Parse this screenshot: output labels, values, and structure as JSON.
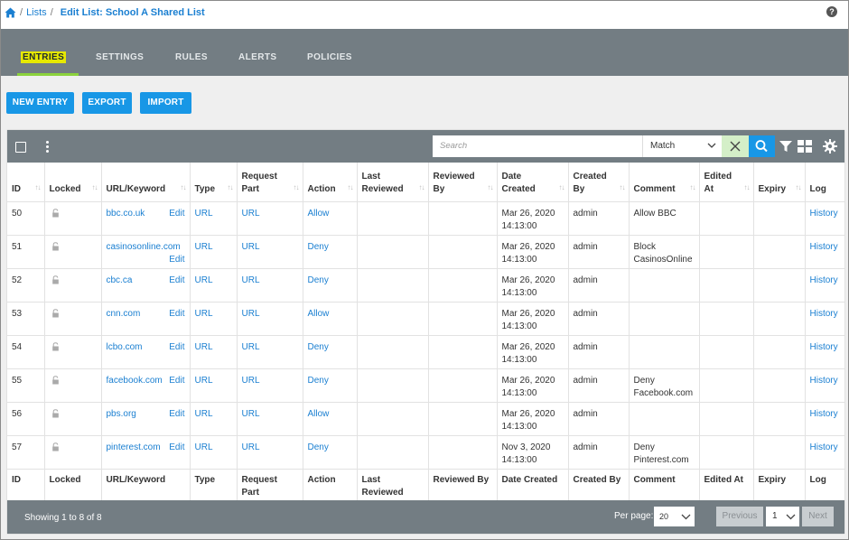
{
  "breadcrumb": {
    "lists_label": "Lists",
    "sep": "/",
    "current": "Edit List: School A Shared List"
  },
  "help_label": "?",
  "tabs": [
    {
      "label": "ENTRIES",
      "active": true
    },
    {
      "label": "SETTINGS",
      "active": false
    },
    {
      "label": "RULES",
      "active": false
    },
    {
      "label": "ALERTS",
      "active": false
    },
    {
      "label": "POLICIES",
      "active": false
    }
  ],
  "actions": {
    "new_entry": "NEW ENTRY",
    "export": "EXPORT",
    "import": "IMPORT"
  },
  "toolbar": {
    "search_placeholder": "Search",
    "match_value": "Match"
  },
  "columns": {
    "id": "ID",
    "locked": "Locked",
    "url": "URL/Keyword",
    "type": "Type",
    "request_part_1": "Request",
    "request_part_2": "Part",
    "action": "Action",
    "last_reviewed_1": "Last",
    "last_reviewed_2": "Reviewed",
    "reviewed_by_1": "Reviewed",
    "reviewed_by_2": "By",
    "date_created_1": "Date",
    "date_created_2": "Created",
    "created_by_1": "Created",
    "created_by_2": "By",
    "comment": "Comment",
    "edited_at_1": "Edited",
    "edited_at_2": "At",
    "expiry": "Expiry",
    "log": "Log"
  },
  "footer_columns": {
    "id": "ID",
    "locked": "Locked",
    "url": "URL/Keyword",
    "type": "Type",
    "request_part_1": "Request",
    "request_part_2": "Part",
    "action": "Action",
    "last_reviewed_1": "Last",
    "last_reviewed_2": "Reviewed",
    "reviewed_by": "Reviewed By",
    "date_created": "Date Created",
    "created_by": "Created By",
    "comment": "Comment",
    "edited_at": "Edited At",
    "expiry": "Expiry",
    "log": "Log"
  },
  "edit_label": "Edit",
  "rows": [
    {
      "id": "50",
      "url": "bbc.co.uk",
      "type": "URL",
      "part": "URL",
      "action": "Allow",
      "date1": "Mar 26, 2020",
      "date2": "14:13:00",
      "by": "admin",
      "comment1": "Allow BBC",
      "comment2": "",
      "log": "History"
    },
    {
      "id": "51",
      "url": "casinosonline.com",
      "type": "URL",
      "part": "URL",
      "action": "Deny",
      "date1": "Mar 26, 2020",
      "date2": "14:13:00",
      "by": "admin",
      "comment1": "Block",
      "comment2": "CasinosOnline",
      "log": "History"
    },
    {
      "id": "52",
      "url": "cbc.ca",
      "type": "URL",
      "part": "URL",
      "action": "Deny",
      "date1": "Mar 26, 2020",
      "date2": "14:13:00",
      "by": "admin",
      "comment1": "",
      "comment2": "",
      "log": "History"
    },
    {
      "id": "53",
      "url": "cnn.com",
      "type": "URL",
      "part": "URL",
      "action": "Allow",
      "date1": "Mar 26, 2020",
      "date2": "14:13:00",
      "by": "admin",
      "comment1": "",
      "comment2": "",
      "log": "History"
    },
    {
      "id": "54",
      "url": "lcbo.com",
      "type": "URL",
      "part": "URL",
      "action": "Deny",
      "date1": "Mar 26, 2020",
      "date2": "14:13:00",
      "by": "admin",
      "comment1": "",
      "comment2": "",
      "log": "History"
    },
    {
      "id": "55",
      "url": "facebook.com",
      "type": "URL",
      "part": "URL",
      "action": "Deny",
      "date1": "Mar 26, 2020",
      "date2": "14:13:00",
      "by": "admin",
      "comment1": "Deny",
      "comment2": "Facebook.com",
      "log": "History"
    },
    {
      "id": "56",
      "url": "pbs.org",
      "type": "URL",
      "part": "URL",
      "action": "Allow",
      "date1": "Mar 26, 2020",
      "date2": "14:13:00",
      "by": "admin",
      "comment1": "",
      "comment2": "",
      "log": "History"
    },
    {
      "id": "57",
      "url": "pinterest.com",
      "type": "URL",
      "part": "URL",
      "action": "Deny",
      "date1": "Nov 3, 2020",
      "date2": "14:13:00",
      "by": "admin",
      "comment1": "Deny",
      "comment2": "Pinterest.com",
      "log": "History"
    }
  ],
  "footer": {
    "showing": "Showing 1 to 8 of 8",
    "per_page_label": "Per page:",
    "per_page_value": "20",
    "previous": "Previous",
    "page_value": "1",
    "next": "Next"
  },
  "colors": {
    "accent": "#1897e6",
    "header_bar": "#737d83",
    "active_tab_highlight": "#e6e800",
    "active_tab_underline": "#8bd23c"
  },
  "icons": [
    "home-icon",
    "help-icon",
    "checkbox-icon",
    "kebab-menu-icon",
    "chevron-down-icon",
    "clear-icon",
    "search-icon",
    "filter-icon",
    "grid-view-icon",
    "gear-icon",
    "lock-icon"
  ]
}
